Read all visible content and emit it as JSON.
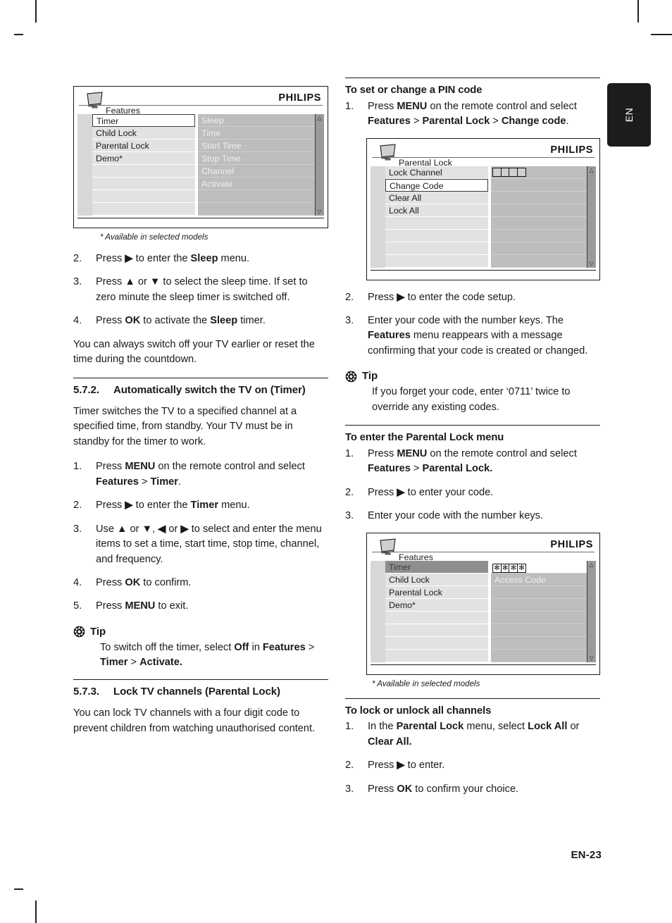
{
  "language_tab": "EN",
  "footer": {
    "page_number": "EN-23"
  },
  "left_column": {
    "figure_features_timer": {
      "brand": "PHILIPS",
      "title": "Features",
      "left_items": [
        "Timer",
        "Child Lock",
        "Parental Lock",
        "Demo*"
      ],
      "left_selected": "Timer",
      "right_items": [
        "Sleep",
        "Time",
        "Start Time",
        "Stop Time",
        "Channel",
        "Activate"
      ],
      "scroll_up": "△",
      "scroll_down": "▽"
    },
    "figure_note": "* Available in selected models",
    "steps_sleep": [
      {
        "num": "2.",
        "html": "Press <b>▶</b> to enter the <b>Sleep</b> menu."
      },
      {
        "num": "3.",
        "html": "Press <b>▲</b> or <b>▼</b> to select the sleep time. If set to zero minute the sleep timer is switched off."
      },
      {
        "num": "4.",
        "html": "Press <b>OK</b> to activate the <b>Sleep</b> timer."
      }
    ],
    "paragraph_switch_off": "You can always switch off your TV earlier or reset the time during the countdown.",
    "section_572": {
      "number": "5.7.2.",
      "title": "Automatically switch the TV on (Timer)"
    },
    "paragraph_timer": "Timer switches the TV to a specified channel at a specified time, from standby. Your TV must be in standby for the timer to work.",
    "steps_timer": [
      {
        "num": "1.",
        "html": "Press <b>MENU</b> on the remote control and select <b>Features</b> &gt; <b>Timer</b>."
      },
      {
        "num": "2.",
        "html": "Press <b>▶</b> to enter the <b>Timer</b> menu."
      },
      {
        "num": "3.",
        "html": "Use <b>▲</b> or <b>▼</b>, <b>◀</b> or <b>▶</b> to select and enter the menu items to set a time, start time, stop time, channel, and frequency."
      },
      {
        "num": "4.",
        "html": "Press <b>OK</b> to confirm."
      },
      {
        "num": "5.",
        "html": "Press <b>MENU</b> to exit."
      }
    ],
    "tip_timer": {
      "label": "Tip",
      "html": "To switch off the timer, select <b>Off</b> in <b>Features</b> &gt; <b>Timer</b> &gt; <b>Activate.</b>"
    },
    "section_573": {
      "number": "5.7.3.",
      "title": "Lock TV channels (Parental Lock)"
    },
    "paragraph_lock": "You can lock TV channels with a four digit code to prevent children from watching unauthorised content."
  },
  "right_column": {
    "heading_pin": "To set or change a PIN code",
    "steps_pin_1": [
      {
        "num": "1.",
        "html": "Press <b>MENU</b> on the remote control and select <b>Features</b> &gt; <b>Parental Lock</b> &gt; <b>Change code</b>."
      }
    ],
    "figure_parental_lock": {
      "brand": "PHILIPS",
      "title": "Parental Lock",
      "left_items": [
        "Lock Channel",
        "Change Code",
        "Clear All",
        "Lock All"
      ],
      "left_selected": "Change Code",
      "pin_boxes": 4,
      "scroll_up": "△",
      "scroll_down": "▽"
    },
    "steps_pin_2": [
      {
        "num": "2.",
        "html": "Press <b>▶</b> to enter the code setup."
      },
      {
        "num": "3.",
        "html": "Enter your code with the number keys. The <b>Features</b> menu reappears with a message confirming that your code is created or changed."
      }
    ],
    "tip_pin": {
      "label": "Tip",
      "html": "If you forget your code, enter ‘0711’ twice to override any existing codes."
    },
    "heading_enter_menu": "To enter the Parental Lock menu",
    "steps_enter_menu": [
      {
        "num": "1.",
        "html": "Press <b>MENU</b> on the remote control and select <b>Features</b> &gt; <b>Parental Lock.</b>"
      },
      {
        "num": "2.",
        "html": "Press <b>▶</b> to enter your code."
      },
      {
        "num": "3.",
        "html": "Enter your code with the number keys."
      }
    ],
    "figure_features_access": {
      "brand": "PHILIPS",
      "title": "Features",
      "left_items": [
        "Timer",
        "Child Lock",
        "Parental Lock",
        "Demo*"
      ],
      "left_selected": "Timer",
      "access_code_label": "Access Code",
      "star_boxes": [
        "✻",
        "✻",
        "✻",
        "✻"
      ],
      "scroll_up": "△",
      "scroll_down": "▽"
    },
    "figure_note": "* Available in selected models",
    "heading_lock_all": "To lock or unlock all channels",
    "steps_lock_all": [
      {
        "num": "1.",
        "html": "In the <b>Parental Lock</b> menu, select <b>Lock All</b> or <b>Clear All.</b>"
      },
      {
        "num": "2.",
        "html": "Press <b>▶</b> to enter."
      },
      {
        "num": "3.",
        "html": "Press <b>OK</b> to confirm your choice."
      }
    ]
  }
}
